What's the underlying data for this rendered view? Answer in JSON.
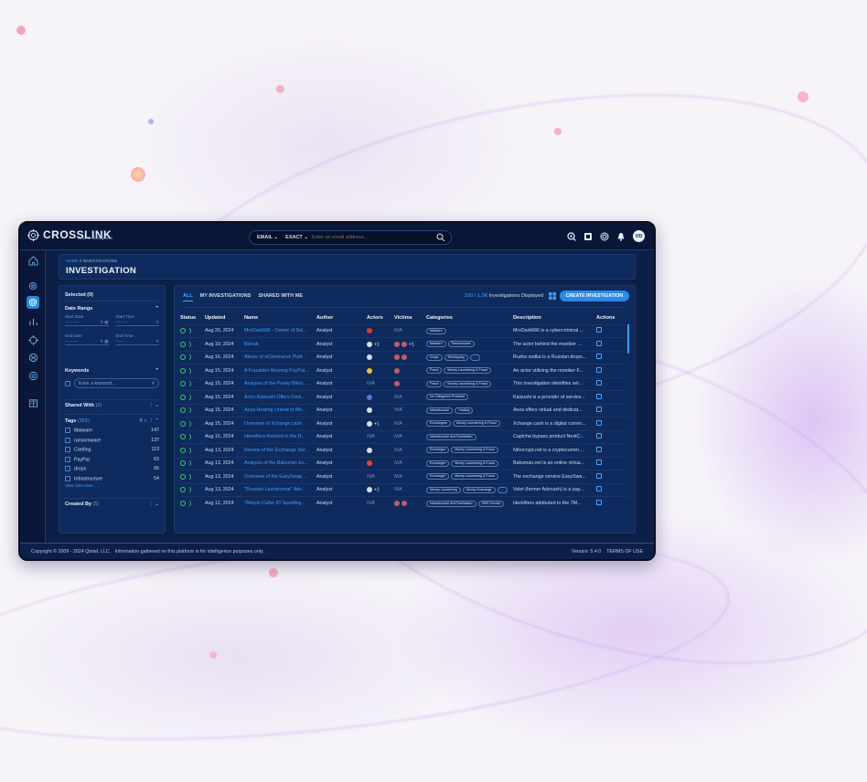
{
  "brand": {
    "name": "CROSSLINK",
    "tagline": "Data to intelligence"
  },
  "search": {
    "type": "EMAIL",
    "mode": "EXACT",
    "placeholder": "Enter an email address..."
  },
  "user": {
    "initials": "VD"
  },
  "breadcrumb": {
    "home": "HOME",
    "separator": "//",
    "current": "INVESTIGATIONS"
  },
  "page_title": "INVESTIGATION",
  "filters": {
    "selected": "Selected (0)",
    "date_range": {
      "title": "Date Range",
      "start_date": "Start Date",
      "start_time": "Start Time",
      "end_date": "End Date",
      "end_time": "End Time",
      "date_placeholder": "--.--.----",
      "time_placeholder": "--:-- --"
    },
    "keywords": {
      "title": "Keywords",
      "placeholder": "Enter a keyword..."
    },
    "shared_with": {
      "title": "Shared With",
      "count": "(3)"
    },
    "tags": {
      "title": "Tags",
      "count": "(351)",
      "items": [
        {
          "label": "Malware",
          "count": "147"
        },
        {
          "label": "ransomware",
          "count": "137"
        },
        {
          "label": "Carding",
          "count": "113"
        },
        {
          "label": "PayPal",
          "count": "63"
        },
        {
          "label": "drops",
          "count": "56"
        },
        {
          "label": "Infrastructure",
          "count": "54"
        }
      ],
      "more": "View 345 more..."
    },
    "created_by": {
      "title": "Created By",
      "count": "(5)"
    }
  },
  "tabs": [
    "ALL",
    "MY INVESTIGATIONS",
    "SHARED WITH ME"
  ],
  "count": {
    "shown": "100",
    "total": "/ 1.2K",
    "suffix": "Investigations Displayed"
  },
  "create_button": "CREATE INVESTIGATION",
  "columns": [
    "Status",
    "Updated",
    "Name",
    "Author",
    "Actors",
    "Victims",
    "Categories",
    "Description",
    "Actions"
  ],
  "rows": [
    {
      "date": "Aug 20, 2024",
      "name": "MrxDark666 - Owner of Sel...",
      "author": "Analyst",
      "actors": {
        "flags": [
          "#d93a3a"
        ],
        "extra": ""
      },
      "victims": {
        "na": "N/A"
      },
      "cats": [
        "Malware"
      ],
      "desc": "MrxDark666 is a cybercriminal ..."
    },
    {
      "date": "Aug 19, 2024",
      "name": "Bslzak",
      "author": "Analyst",
      "actors": {
        "flags": [
          "#d8dde8"
        ],
        "extra": "+1"
      },
      "victims": {
        "flags": [
          "#c45a6a",
          "#c45a6a"
        ],
        "extra": "+1"
      },
      "cats": [
        "Malware",
        "Ransomware"
      ],
      "desc": "The actor behind the moniker ..."
    },
    {
      "date": "Aug 16, 2024",
      "name": "Abuse of eCommerce Platf...",
      "author": "Analyst",
      "actors": {
        "flags": [
          "#d8dde8"
        ],
        "extra": ""
      },
      "victims": {
        "flags": [
          "#c45a6a",
          "#c45a6a"
        ],
        "extra": ""
      },
      "cats": [
        "Drops",
        "Reshipping",
        "..."
      ],
      "desc": "Ruzke.vodka is a Russian drops..."
    },
    {
      "date": "Aug 15, 2024",
      "name": "A Fraudster Abusing PayPal...",
      "author": "Analyst",
      "actors": {
        "flags": [
          "#e8c43a"
        ],
        "extra": ""
      },
      "victims": {
        "flags": [
          "#c45a6a"
        ],
        "extra": ""
      },
      "cats": [
        "Fraud",
        "Money Laundering & Fraud"
      ],
      "desc": "An actor utilizing the moniker F..."
    },
    {
      "date": "Aug 15, 2024",
      "name": "Analysis of the Peaky Blind...",
      "author": "Analyst",
      "actors": {
        "na": "N/A"
      },
      "victims": {
        "flags": [
          "#c45a6a"
        ],
        "extra": ""
      },
      "cats": [
        "Fraud",
        "Money Laundering & Fraud"
      ],
      "desc": "This investigation identifies sel..."
    },
    {
      "date": "Aug 15, 2024",
      "name": "Actor Kaizushi Offers Dark...",
      "author": "Analyst",
      "actors": {
        "flags": [
          "#5a78c8"
        ],
        "extra": ""
      },
      "victims": {
        "na": "N/A"
      },
      "cats": [
        "No Categories Provided"
      ],
      "desc": "Kaizushi is a provider of service..."
    },
    {
      "date": "Aug 15, 2024",
      "name": "Aeza Hosting Linked to Me...",
      "author": "Analyst",
      "actors": {
        "flags": [
          "#d8dde8"
        ],
        "extra": ""
      },
      "victims": {
        "na": "N/A"
      },
      "cats": [
        "Infrastructure",
        "Hosting"
      ],
      "desc": "Aeza offers virtual and dedicat..."
    },
    {
      "date": "Aug 15, 2024",
      "name": "Overview of Xchange.cash",
      "author": "Analyst",
      "actors": {
        "flags": [
          "#d8dde8"
        ],
        "extra": "+1"
      },
      "victims": {
        "na": "N/A"
      },
      "cats": [
        "Exchangers",
        "Money Laundering & Fraud"
      ],
      "desc": "Xchange.cash is a digital curren..."
    },
    {
      "date": "Aug 15, 2024",
      "name": "Identifiers Related to the R...",
      "author": "Analyst",
      "actors": {
        "na": "N/A"
      },
      "victims": {
        "na": "N/A"
      },
      "cats": [
        "Infrastructure And Facilitation"
      ],
      "desc": "Captcha bypass product NextC..."
    },
    {
      "date": "Aug 13, 2024",
      "name": "Review of the Exchange Ser...",
      "author": "Analyst",
      "actors": {
        "flags": [
          "#d8dde8"
        ],
        "extra": ""
      },
      "victims": {
        "na": "N/A"
      },
      "cats": [
        "Exchanger",
        "Money Laundering & Fraud"
      ],
      "desc": "Nitrocrypt.net is a cryptocurren..."
    },
    {
      "date": "Aug 13, 2024",
      "name": "Analysis of the Baksman Ex...",
      "author": "Analyst",
      "actors": {
        "flags": [
          "#d94a2a"
        ],
        "extra": ""
      },
      "victims": {
        "na": "N/A"
      },
      "cats": [
        "Exchanger",
        "Money Laundering & Fraud"
      ],
      "desc": "Baksman.net is an online virtua..."
    },
    {
      "date": "Aug 13, 2024",
      "name": "Overview of the EasySwap ...",
      "author": "Analyst",
      "actors": {
        "na": "N/A"
      },
      "victims": {
        "na": "N/A"
      },
      "cats": [
        "Exchanger",
        "Money Laundering & Fraud"
      ],
      "desc": "The exchange service EasySwa..."
    },
    {
      "date": "Aug 13, 2024",
      "name": "\"Russian Laundromat\" Adv...",
      "author": "Analyst",
      "actors": {
        "flags": [
          "#d8dde8"
        ],
        "extra": "+2"
      },
      "victims": {
        "na": "N/A"
      },
      "cats": [
        "Money Laundering",
        "Money Exchange",
        "..."
      ],
      "desc": "Volet (former Advcash) is a pay..."
    },
    {
      "date": "Aug 12, 2024",
      "name": "7Morph Caller ID Spoofing...",
      "author": "Analyst",
      "actors": {
        "na": "N/A"
      },
      "victims": {
        "flags": [
          "#c45a6a",
          "#c45a6a"
        ],
        "extra": ""
      },
      "cats": [
        "Infrastructure And Facilitation",
        "SMS Service"
      ],
      "desc": "Identifiers attributed to the 7M..."
    }
  ],
  "footer": {
    "copyright": "Copyright © 2009 - 2024 Qintel, LLC.",
    "notice": "Information gathered on this platform is for intelligence purposes only.",
    "version": "Version: 5.4.0",
    "terms": "TERMS OF USE"
  }
}
